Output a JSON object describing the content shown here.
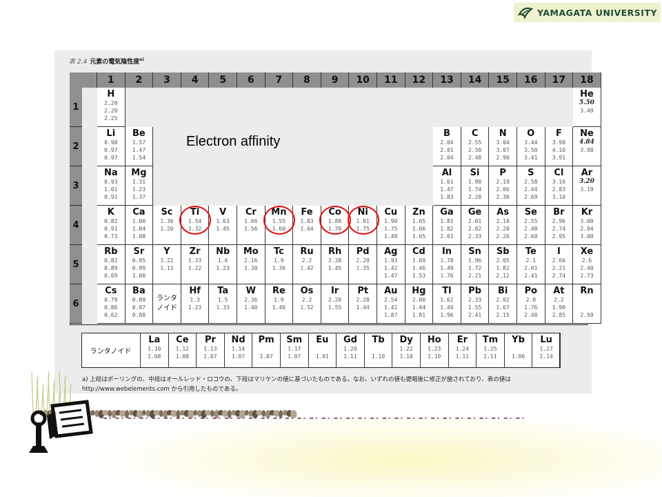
{
  "logo": {
    "text": "YAMAGATA UNIVERSITY"
  },
  "overlay_label": "Electron affinity",
  "table": {
    "caption_tag": "表 2.4",
    "caption": "元素の電気陰性度",
    "caption_sup": "a)",
    "groups": [
      "1",
      "2",
      "3",
      "4",
      "5",
      "6",
      "7",
      "8",
      "9",
      "10",
      "11",
      "12",
      "13",
      "14",
      "15",
      "16",
      "17",
      "18"
    ],
    "periods": [
      "1",
      "2",
      "3",
      "4",
      "5",
      "6"
    ],
    "lanthanoid_block_label": "ランタ\nノイド",
    "cells": [
      {
        "p": 1,
        "g": 1,
        "sym": "H",
        "vals": [
          "2.20",
          "2.20",
          "2.25"
        ]
      },
      {
        "p": 1,
        "g": 18,
        "sym": "He",
        "vals": [
          "5.50",
          "3.49"
        ],
        "hw": true
      },
      {
        "p": 2,
        "g": 1,
        "sym": "Li",
        "vals": [
          "0.98",
          "0.97",
          "0.97"
        ]
      },
      {
        "p": 2,
        "g": 2,
        "sym": "Be",
        "vals": [
          "1.57",
          "1.47",
          "1.54"
        ]
      },
      {
        "p": 2,
        "g": 13,
        "sym": "B",
        "vals": [
          "2.04",
          "2.01",
          "2.04"
        ]
      },
      {
        "p": 2,
        "g": 14,
        "sym": "C",
        "vals": [
          "2.55",
          "2.50",
          "2.48"
        ]
      },
      {
        "p": 2,
        "g": 15,
        "sym": "N",
        "vals": [
          "3.04",
          "3.07",
          "2.90"
        ]
      },
      {
        "p": 2,
        "g": 16,
        "sym": "O",
        "vals": [
          "3.44",
          "3.50",
          "3.41"
        ]
      },
      {
        "p": 2,
        "g": 17,
        "sym": "F",
        "vals": [
          "3.98",
          "4.10",
          "3.91"
        ]
      },
      {
        "p": 2,
        "g": 18,
        "sym": "Ne",
        "vals": [
          "4.84",
          "3.98"
        ],
        "hw": true
      },
      {
        "p": 3,
        "g": 1,
        "sym": "Na",
        "vals": [
          "0.93",
          "1.01",
          "0.91"
        ]
      },
      {
        "p": 3,
        "g": 2,
        "sym": "Mg",
        "vals": [
          "1.31",
          "1.23",
          "1.37"
        ]
      },
      {
        "p": 3,
        "g": 13,
        "sym": "Al",
        "vals": [
          "1.61",
          "1.47",
          "1.83"
        ]
      },
      {
        "p": 3,
        "g": 14,
        "sym": "Si",
        "vals": [
          "1.90",
          "1.74",
          "2.28"
        ]
      },
      {
        "p": 3,
        "g": 15,
        "sym": "P",
        "vals": [
          "2.19",
          "2.06",
          "2.30"
        ]
      },
      {
        "p": 3,
        "g": 16,
        "sym": "S",
        "vals": [
          "2.58",
          "2.44",
          "2.69"
        ]
      },
      {
        "p": 3,
        "g": 17,
        "sym": "Cl",
        "vals": [
          "3.16",
          "2.83",
          "3.10"
        ]
      },
      {
        "p": 3,
        "g": 18,
        "sym": "Ar",
        "vals": [
          "3.20",
          "3.19"
        ],
        "hw": true
      },
      {
        "p": 4,
        "g": 1,
        "sym": "K",
        "vals": [
          "0.82",
          "0.91",
          "0.73"
        ]
      },
      {
        "p": 4,
        "g": 2,
        "sym": "Ca",
        "vals": [
          "1.00",
          "1.04",
          "1.08"
        ]
      },
      {
        "p": 4,
        "g": 3,
        "sym": "Sc",
        "vals": [
          "1.36",
          "1.20",
          ""
        ]
      },
      {
        "p": 4,
        "g": 4,
        "sym": "Ti",
        "vals": [
          "1.54",
          "1.32",
          ""
        ]
      },
      {
        "p": 4,
        "g": 5,
        "sym": "V",
        "vals": [
          "1.63",
          "1.45",
          ""
        ]
      },
      {
        "p": 4,
        "g": 6,
        "sym": "Cr",
        "vals": [
          "1.66",
          "1.56",
          ""
        ]
      },
      {
        "p": 4,
        "g": 7,
        "sym": "Mn",
        "vals": [
          "1.55",
          "1.60",
          ""
        ]
      },
      {
        "p": 4,
        "g": 8,
        "sym": "Fe",
        "vals": [
          "1.83",
          "1.64",
          ""
        ]
      },
      {
        "p": 4,
        "g": 9,
        "sym": "Co",
        "vals": [
          "1.88",
          "1.70",
          ""
        ]
      },
      {
        "p": 4,
        "g": 10,
        "sym": "Ni",
        "vals": [
          "1.91",
          "1.75",
          ""
        ]
      },
      {
        "p": 4,
        "g": 11,
        "sym": "Cu",
        "vals": [
          "1.90",
          "1.75",
          "1.49"
        ]
      },
      {
        "p": 4,
        "g": 12,
        "sym": "Zn",
        "vals": [
          "1.65",
          "1.66",
          "1.65"
        ]
      },
      {
        "p": 4,
        "g": 13,
        "sym": "Ga",
        "vals": [
          "1.81",
          "1.82",
          "2.01"
        ]
      },
      {
        "p": 4,
        "g": 14,
        "sym": "Ge",
        "vals": [
          "2.01",
          "2.02",
          "2.33"
        ]
      },
      {
        "p": 4,
        "g": 15,
        "sym": "As",
        "vals": [
          "2.18",
          "2.20",
          "2.26"
        ]
      },
      {
        "p": 4,
        "g": 16,
        "sym": "Se",
        "vals": [
          "2.55",
          "2.48",
          "2.60"
        ]
      },
      {
        "p": 4,
        "g": 17,
        "sym": "Br",
        "vals": [
          "2.96",
          "2.74",
          "2.95"
        ]
      },
      {
        "p": 4,
        "g": 18,
        "sym": "Kr",
        "vals": [
          "3.00",
          "2.94",
          "3.00"
        ]
      },
      {
        "p": 5,
        "g": 1,
        "sym": "Rb",
        "vals": [
          "0.82",
          "0.89",
          "0.69"
        ]
      },
      {
        "p": 5,
        "g": 2,
        "sym": "Sr",
        "vals": [
          "0.95",
          "0.99",
          "1.00"
        ]
      },
      {
        "p": 5,
        "g": 3,
        "sym": "Y",
        "vals": [
          "1.22",
          "1.11",
          ""
        ]
      },
      {
        "p": 5,
        "g": 4,
        "sym": "Zr",
        "vals": [
          "1.33",
          "1.22",
          ""
        ]
      },
      {
        "p": 5,
        "g": 5,
        "sym": "Nb",
        "vals": [
          "1.6",
          "1.23",
          ""
        ]
      },
      {
        "p": 5,
        "g": 6,
        "sym": "Mo",
        "vals": [
          "2.16",
          "1.30",
          ""
        ]
      },
      {
        "p": 5,
        "g": 7,
        "sym": "Tc",
        "vals": [
          "1.9",
          "1.36",
          ""
        ]
      },
      {
        "p": 5,
        "g": 8,
        "sym": "Ru",
        "vals": [
          "2.2",
          "1.42",
          ""
        ]
      },
      {
        "p": 5,
        "g": 9,
        "sym": "Rh",
        "vals": [
          "2.28",
          "1.45",
          ""
        ]
      },
      {
        "p": 5,
        "g": 10,
        "sym": "Pd",
        "vals": [
          "2.20",
          "1.35",
          ""
        ]
      },
      {
        "p": 5,
        "g": 11,
        "sym": "Ag",
        "vals": [
          "1.93",
          "1.42",
          "1.47"
        ]
      },
      {
        "p": 5,
        "g": 12,
        "sym": "Cd",
        "vals": [
          "1.69",
          "1.46",
          "1.53"
        ]
      },
      {
        "p": 5,
        "g": 13,
        "sym": "In",
        "vals": [
          "1.78",
          "1.49",
          "1.76"
        ]
      },
      {
        "p": 5,
        "g": 14,
        "sym": "Sn",
        "vals": [
          "1.96",
          "1.72",
          "2.21"
        ]
      },
      {
        "p": 5,
        "g": 15,
        "sym": "Sb",
        "vals": [
          "2.05",
          "1.82",
          "2.12"
        ]
      },
      {
        "p": 5,
        "g": 16,
        "sym": "Te",
        "vals": [
          "2.1",
          "2.01",
          "2.41"
        ]
      },
      {
        "p": 5,
        "g": 17,
        "sym": "I",
        "vals": [
          "2.66",
          "2.21",
          "2.74"
        ]
      },
      {
        "p": 5,
        "g": 18,
        "sym": "Xe",
        "vals": [
          "2.6",
          "2.40",
          "2.73"
        ]
      },
      {
        "p": 6,
        "g": 1,
        "sym": "Cs",
        "vals": [
          "0.79",
          "0.86",
          "0.62"
        ]
      },
      {
        "p": 6,
        "g": 2,
        "sym": "Ba",
        "vals": [
          "0.89",
          "0.97",
          "0.88"
        ]
      },
      {
        "p": 6,
        "g": 4,
        "sym": "Hf",
        "vals": [
          "1.3",
          "1.23",
          ""
        ]
      },
      {
        "p": 6,
        "g": 5,
        "sym": "Ta",
        "vals": [
          "1.5",
          "1.33",
          ""
        ]
      },
      {
        "p": 6,
        "g": 6,
        "sym": "W",
        "vals": [
          "2.36",
          "1.40",
          ""
        ]
      },
      {
        "p": 6,
        "g": 7,
        "sym": "Re",
        "vals": [
          "1.9",
          "1.46",
          ""
        ]
      },
      {
        "p": 6,
        "g": 8,
        "sym": "Os",
        "vals": [
          "2.2",
          "1.52",
          ""
        ]
      },
      {
        "p": 6,
        "g": 9,
        "sym": "Ir",
        "vals": [
          "2.20",
          "1.55",
          ""
        ]
      },
      {
        "p": 6,
        "g": 10,
        "sym": "Pt",
        "vals": [
          "2.28",
          "1.44",
          ""
        ]
      },
      {
        "p": 6,
        "g": 11,
        "sym": "Au",
        "vals": [
          "2.54",
          "1.42",
          "1.87"
        ]
      },
      {
        "p": 6,
        "g": 12,
        "sym": "Hg",
        "vals": [
          "2.00",
          "1.44",
          "1.81"
        ]
      },
      {
        "p": 6,
        "g": 13,
        "sym": "Tl",
        "vals": [
          "1.62",
          "1.44",
          "1.96"
        ]
      },
      {
        "p": 6,
        "g": 14,
        "sym": "Pb",
        "vals": [
          "2.33",
          "1.55",
          "2.41"
        ]
      },
      {
        "p": 6,
        "g": 15,
        "sym": "Bi",
        "vals": [
          "2.02",
          "1.67",
          "2.15"
        ]
      },
      {
        "p": 6,
        "g": 16,
        "sym": "Po",
        "vals": [
          "2.0",
          "1.76",
          "2.48"
        ]
      },
      {
        "p": 6,
        "g": 17,
        "sym": "At",
        "vals": [
          "2.2",
          "1.90",
          "2.85"
        ]
      },
      {
        "p": 6,
        "g": 18,
        "sym": "Rn",
        "vals": [
          "",
          "",
          "2.59"
        ]
      }
    ],
    "lanthanoid_row_label": "ランタノイド",
    "lanthanoids": [
      {
        "sym": "La",
        "vals": [
          "1.10",
          "1.08"
        ]
      },
      {
        "sym": "Ce",
        "vals": [
          "1.12",
          "1.08"
        ]
      },
      {
        "sym": "Pr",
        "vals": [
          "1.13",
          "1.07"
        ]
      },
      {
        "sym": "Nd",
        "vals": [
          "1.14",
          "1.07"
        ]
      },
      {
        "sym": "Pm",
        "vals": [
          "",
          "1.07"
        ]
      },
      {
        "sym": "Sm",
        "vals": [
          "1.17",
          "1.07"
        ]
      },
      {
        "sym": "Eu",
        "vals": [
          "",
          "1.01"
        ]
      },
      {
        "sym": "Gd",
        "vals": [
          "1.20",
          "1.11"
        ]
      },
      {
        "sym": "Tb",
        "vals": [
          "",
          "1.10"
        ]
      },
      {
        "sym": "Dy",
        "vals": [
          "1.22",
          "1.10"
        ]
      },
      {
        "sym": "Ho",
        "vals": [
          "1.23",
          "1.10"
        ]
      },
      {
        "sym": "Er",
        "vals": [
          "1.24",
          "1.11"
        ]
      },
      {
        "sym": "Tm",
        "vals": [
          "1.25",
          "1.11"
        ]
      },
      {
        "sym": "Yb",
        "vals": [
          "",
          "1.06"
        ]
      },
      {
        "sym": "Lu",
        "vals": [
          "1.27",
          "1.14"
        ]
      }
    ],
    "footnote_line1": "a) 上段はポーリングの、中段はオールレッド・ロコウの、下段はマリケンの値に基づいたものである。なお、いずれの値も提唱後に修正が施されており、表の値は",
    "footnote_line2": "http://www.webelements.com から引用したものである。"
  },
  "highlighted_elements": [
    "Ti",
    "Mn",
    "Co",
    "Ni"
  ],
  "colors": {
    "highlight": "#e01010",
    "header_gray": "#8f8f8f",
    "logo_bg": "#eef2cf",
    "logo_text": "#234a34"
  }
}
